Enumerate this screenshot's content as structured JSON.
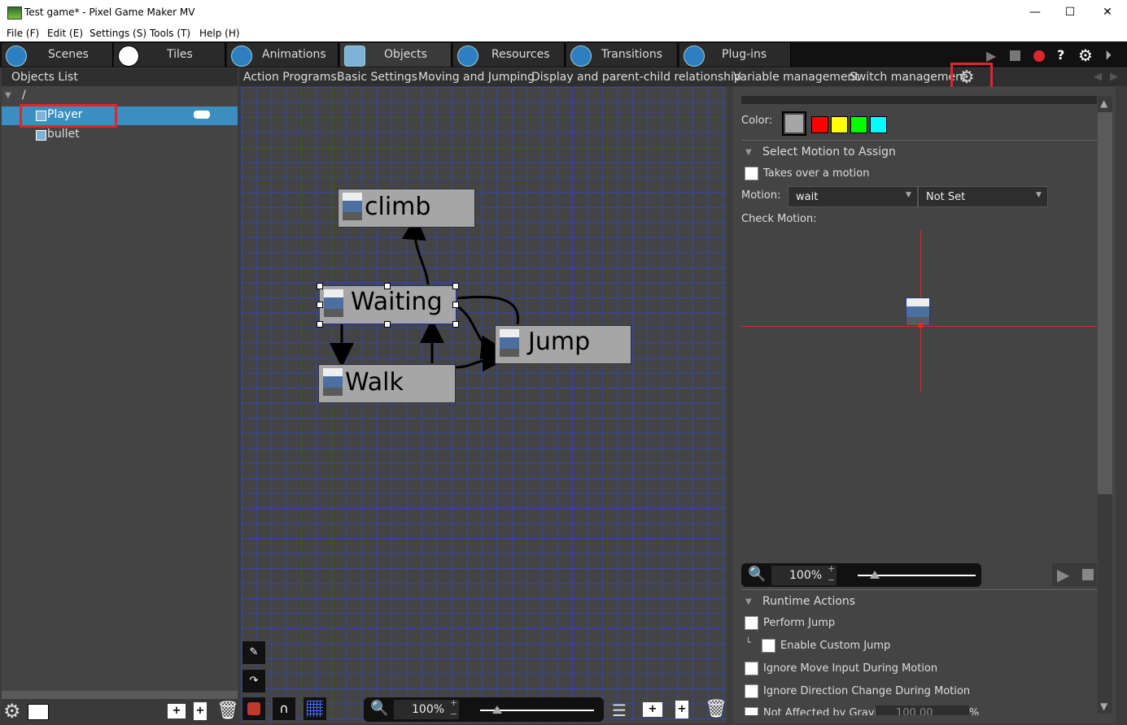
{
  "window": {
    "title": "Test game* - Pixel Game Maker MV",
    "minimize": "—",
    "maximize": "☐",
    "close": "✕"
  },
  "menu": [
    "File (F)",
    "Edit (E)",
    "Settings (S)",
    "Tools (T)",
    "Help (H)"
  ],
  "module_tabs": [
    {
      "label": "Scenes",
      "icon": "scenes-icon"
    },
    {
      "label": "Tiles",
      "icon": "tiles-icon"
    },
    {
      "label": "Animations",
      "icon": "animations-icon"
    },
    {
      "label": "Objects",
      "icon": "objects-icon",
      "active": true
    },
    {
      "label": "Resources",
      "icon": "resources-icon"
    },
    {
      "label": "Transitions",
      "icon": "transitions-icon"
    },
    {
      "label": "Plug-ins",
      "icon": "plugins-icon"
    }
  ],
  "toolbar_right": {
    "help": "?"
  },
  "left_panel": {
    "title": "Objects List",
    "root": "/",
    "items": [
      "Player",
      "bullet"
    ]
  },
  "sub_tabs": [
    "Action Programs",
    "Basic Settings",
    "Moving and Jumping",
    "Display and parent-child relationship",
    "Variable management",
    "Switch management"
  ],
  "canvas": {
    "nodes": [
      "climb",
      "Waiting",
      "Jump",
      "Walk"
    ],
    "zoom": "100%",
    "zoom_plus": "+",
    "zoom_minus": "−"
  },
  "right_panel": {
    "color_label": "Color:",
    "colors": [
      "#a6a6a6",
      "#ff0000",
      "#ffff00",
      "#00ff00",
      "#00ffff"
    ],
    "select_motion_section": "Select Motion to Assign",
    "takes_over": "Takes over a motion",
    "motion_label": "Motion:",
    "motion_value": "wait",
    "motion_second": "Not Set",
    "check_motion_label": "Check Motion:",
    "preview_zoom": "100%",
    "runtime_section": "Runtime Actions",
    "runtime_items": [
      "Perform Jump",
      "Enable Custom Jump",
      "Ignore Move Input During Motion",
      "Ignore Direction Change During Motion",
      "Not Affected by Gravity"
    ],
    "gravity_value": "100.00",
    "gravity_unit": "%"
  }
}
